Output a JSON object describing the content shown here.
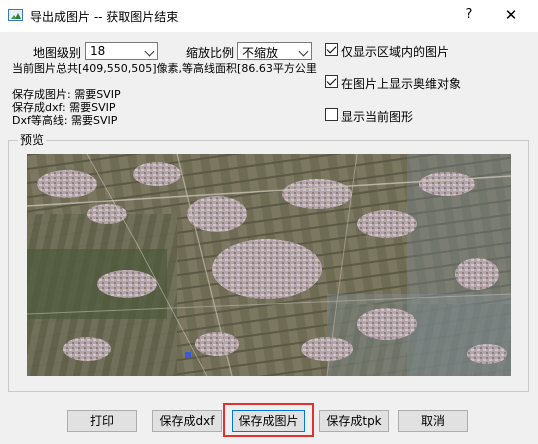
{
  "window": {
    "title": "导出成图片 -- 获取图片结束",
    "help_label": "?",
    "close_label": "✕"
  },
  "form": {
    "map_level_label": "地图级别",
    "map_level_value": "18",
    "scale_label": "缩放比例",
    "scale_value": "不缩放",
    "info_lines": [
      "当前图片总共[409,550,505]像素,等高线面积[86.63平方公里",
      "保存成图片: 需要SVIP",
      "保存成dxf: 需要SVIP",
      "Dxf等高线: 需要SVIP"
    ],
    "checkboxes": [
      {
        "label": "仅显示区域内的图片",
        "checked": true
      },
      {
        "label": "在图片上显示奥维对象",
        "checked": true
      },
      {
        "label": "显示当前图形",
        "checked": false
      }
    ]
  },
  "preview": {
    "group_title": "预览"
  },
  "buttons": {
    "print": "打印",
    "save_dxf": "保存成dxf",
    "save_image": "保存成图片",
    "save_tpk": "保存成tpk",
    "cancel": "取消"
  },
  "colors": {
    "highlight_border": "#e03030",
    "default_button_border": "#0078d7"
  }
}
